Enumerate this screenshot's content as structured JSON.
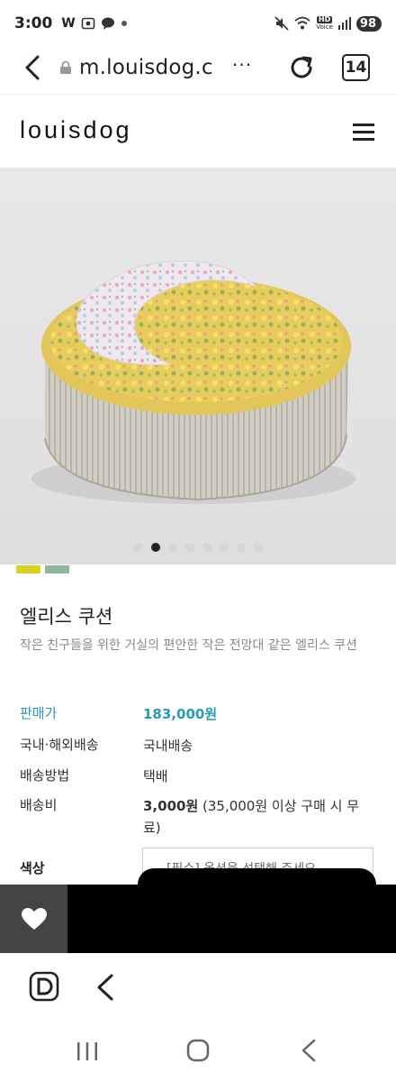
{
  "status_bar": {
    "time": "3:00",
    "left_icons": [
      "W",
      "photo-icon",
      "talk-icon",
      "dot"
    ],
    "right_icons": [
      "mute-icon",
      "wifi-icon",
      "hd-voice-icon",
      "signal-icon"
    ],
    "hd_label": "HD",
    "voice_label": "Voice",
    "battery": "98"
  },
  "browser": {
    "url": "m.louisdog.c",
    "more": "···",
    "tab_count": "14"
  },
  "site": {
    "brand": "louisdog"
  },
  "carousel": {
    "dot_count": 8,
    "active_index": 1
  },
  "colors": {
    "swatch_1": "#d8d223",
    "swatch_2": "#8fb59c",
    "price_accent": "#2a9bb5"
  },
  "product": {
    "name": "엘리스 쿠션",
    "description": "작은 친구들을 위한 거실의 편안한 작은 전망대 같은 엘리스 쿠션",
    "price_label": "판매가",
    "price_value": "183,000원",
    "shipping_region_label": "국내·해외배송",
    "shipping_region_value": "국내배송",
    "shipping_method_label": "배송방법",
    "shipping_method_value": "택배",
    "shipping_fee_label": "배송비",
    "shipping_fee_amount": "3,000원",
    "shipping_fee_note": " (35,000원 이상 구매 시 무료)",
    "color_label": "색상",
    "option_placeholder": "[필수] 옵션을 선택해 주세요"
  },
  "actions": {
    "wishlist_icon": "heart-icon"
  }
}
